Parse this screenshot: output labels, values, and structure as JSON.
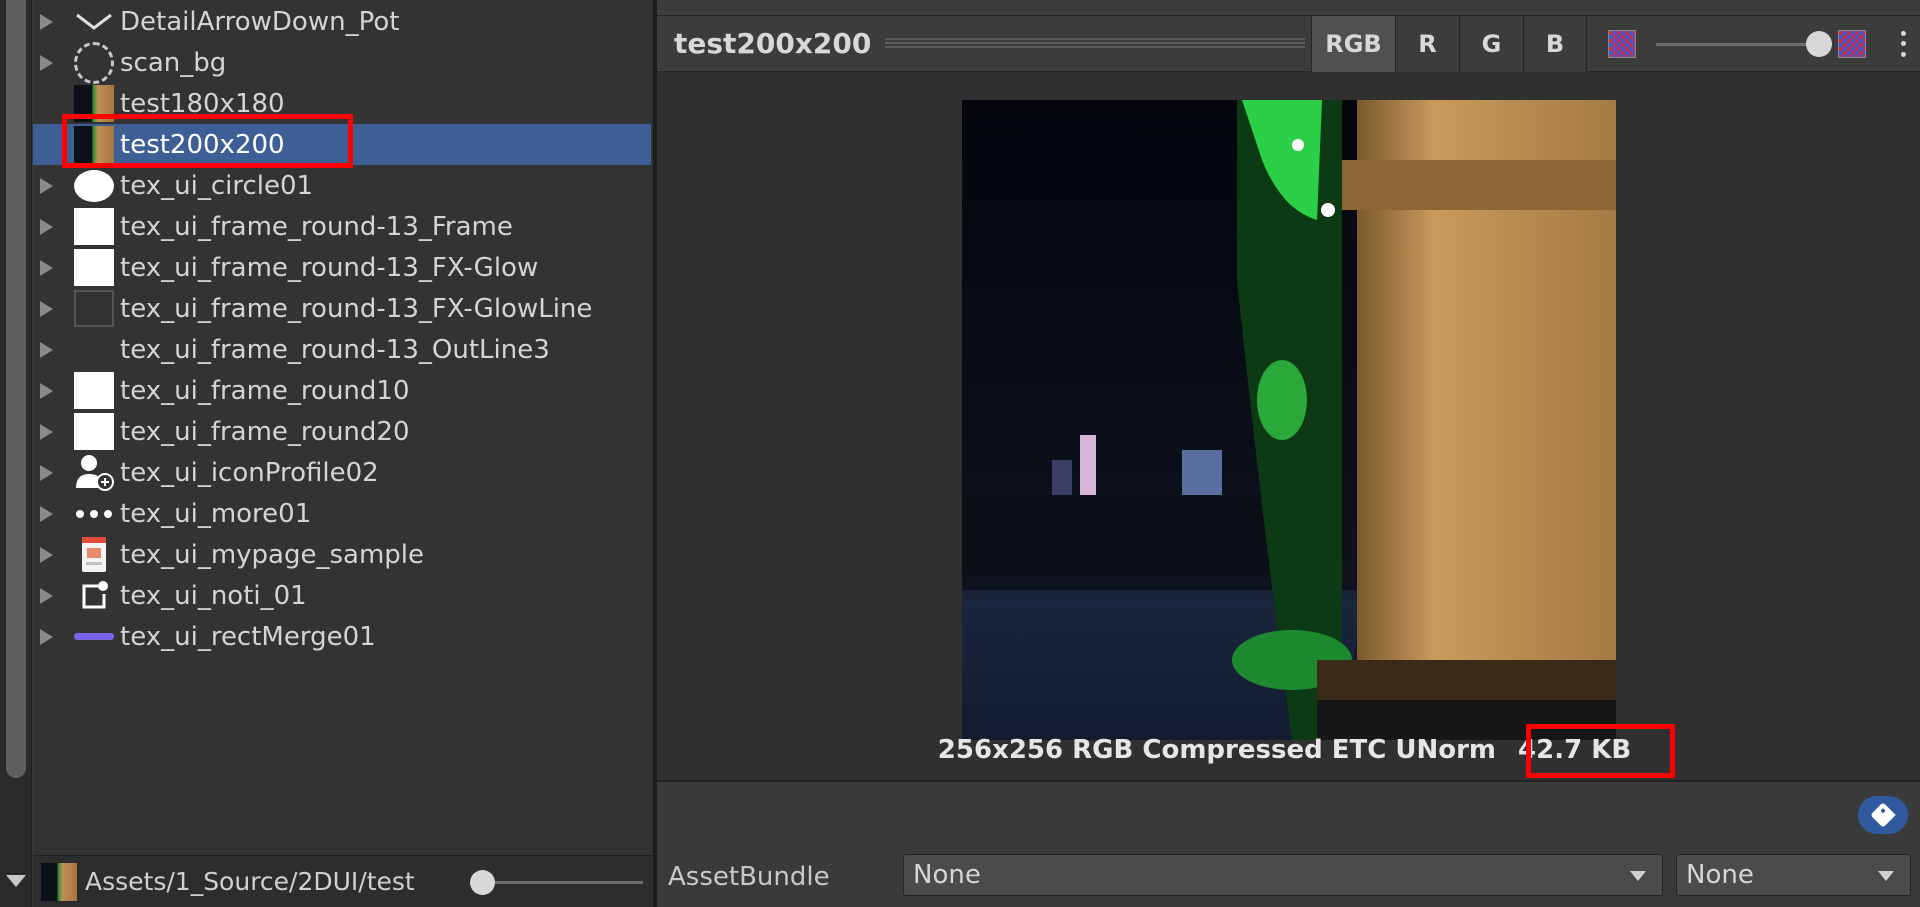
{
  "asset_list": {
    "items": [
      {
        "label": "DetailArrowDown_Pot",
        "icon": "chevron-down-icon",
        "foldable": true
      },
      {
        "label": "scan_bg",
        "icon": "dashed-circle-icon",
        "foldable": true
      },
      {
        "label": "test180x180",
        "icon": "photo-thumbnail-icon",
        "foldable": false
      },
      {
        "label": "test200x200",
        "icon": "photo-thumbnail-icon",
        "foldable": false,
        "selected": true
      },
      {
        "label": "tex_ui_circle01",
        "icon": "white-circle-icon",
        "foldable": true
      },
      {
        "label": "tex_ui_frame_round-13_Frame",
        "icon": "white-square-icon",
        "foldable": true
      },
      {
        "label": "tex_ui_frame_round-13_FX-Glow",
        "icon": "white-square-icon",
        "foldable": true
      },
      {
        "label": "tex_ui_frame_round-13_FX-GlowLine",
        "icon": "outline-square-icon",
        "foldable": true
      },
      {
        "label": "tex_ui_frame_round-13_OutLine3",
        "icon": "blank-icon",
        "foldable": true
      },
      {
        "label": "tex_ui_frame_round10",
        "icon": "white-square-icon",
        "foldable": true
      },
      {
        "label": "tex_ui_frame_round20",
        "icon": "white-square-icon",
        "foldable": true
      },
      {
        "label": "tex_ui_iconProfile02",
        "icon": "profile-add-icon",
        "foldable": true
      },
      {
        "label": "tex_ui_more01",
        "icon": "more-dots-icon",
        "foldable": true
      },
      {
        "label": "tex_ui_mypage_sample",
        "icon": "phone-mockup-icon",
        "foldable": true
      },
      {
        "label": "tex_ui_noti_01",
        "icon": "notification-icon",
        "foldable": true
      },
      {
        "label": "tex_ui_rectMerge01",
        "icon": "purple-bar-icon",
        "foldable": true
      }
    ]
  },
  "path_bar": {
    "path": "Assets/1_Source/2DUI/test"
  },
  "preview": {
    "title": "test200x200",
    "channels": [
      "RGB",
      "R",
      "G",
      "B"
    ],
    "active_channel": "RGB",
    "info_format": "256x256  RGB Compressed ETC UNorm",
    "info_size": "42.7 KB"
  },
  "labels": {
    "asset_bundle_label": "AssetBundle",
    "asset_bundle_value": "None",
    "asset_bundle_variant": "None"
  },
  "colors": {
    "selection": "#3e5f96",
    "highlight": "#ff0000",
    "accent_tag": "#2f5a9e"
  }
}
